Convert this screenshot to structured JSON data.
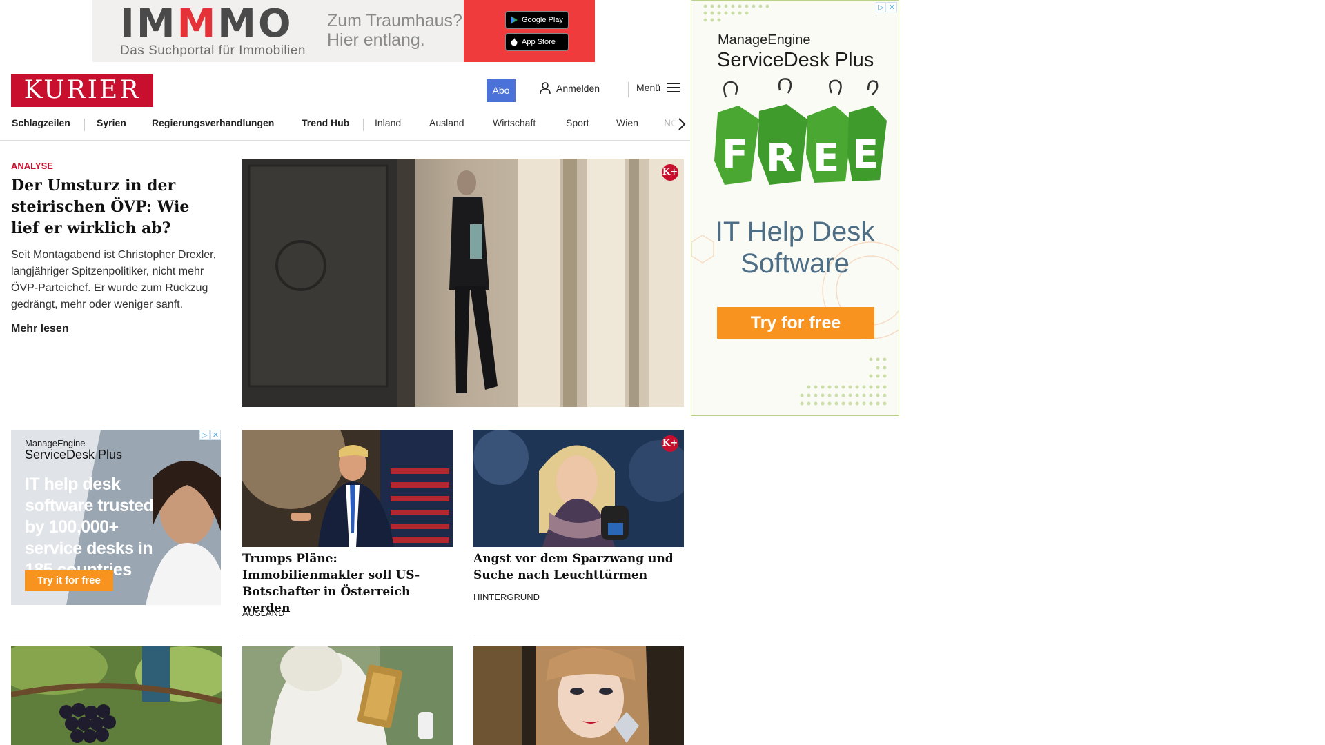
{
  "top_ad": {
    "brand_prefix": "IM",
    "brand_highlight": "M",
    "brand_suffix": "MO",
    "tagline_line1": "Zum Traumhaus?",
    "tagline_line2": "Hier entlang.",
    "subline": "Das Suchportal für Immobilien",
    "google_play": "Google Play",
    "app_store": "App Store"
  },
  "side_ad": {
    "vendor": "ManageEngine",
    "product": "ServiceDesk Plus",
    "free": "FREE",
    "headline_line1": "IT Help Desk",
    "headline_line2": "Software",
    "cta": "Try for free"
  },
  "header": {
    "logo": "KURIER",
    "abo": "Abo",
    "login": "Anmelden",
    "menu": "Menü"
  },
  "nav": {
    "items": [
      "Schlagzeilen",
      "Syrien",
      "Regierungsverhandlungen",
      "Trend Hub",
      "Inland",
      "Ausland",
      "Wirtschaft",
      "Sport",
      "Wien",
      "NÖ"
    ]
  },
  "lead": {
    "kicker": "ANALYSE",
    "title": "Der Umsturz in der steiri­schen ÖVP: Wie lief er wirklich ab?",
    "teaser": "Seit Montagabend ist Christopher Drexler, langjähriger Spitzenpolitiker, nicht mehr ÖVP-Parteichef. Er wurde zum Rückzug gedrängt, mehr oder weniger sanft.",
    "more": "Mehr lesen",
    "badge": "K+"
  },
  "small_ad": {
    "vendor": "ManageEngine",
    "product": "ServiceDesk Plus",
    "headline": "IT help desk software trusted by 100,000+ service desks in 185 countries",
    "cta": "Try it for free"
  },
  "cards": [
    {
      "title": "Trumps Pläne: Immobilienmakler soll US-Botschafter in Österreich werden",
      "category": "Ausland"
    },
    {
      "title": "Angst vor dem Sparzwang und Su­che nach Leuchttürmen",
      "category": "Hintergrund",
      "badge": "K+"
    }
  ],
  "colors": {
    "brand_red": "#c8102e",
    "abo_blue": "#4a72d8",
    "ad_orange": "#f7931e"
  }
}
